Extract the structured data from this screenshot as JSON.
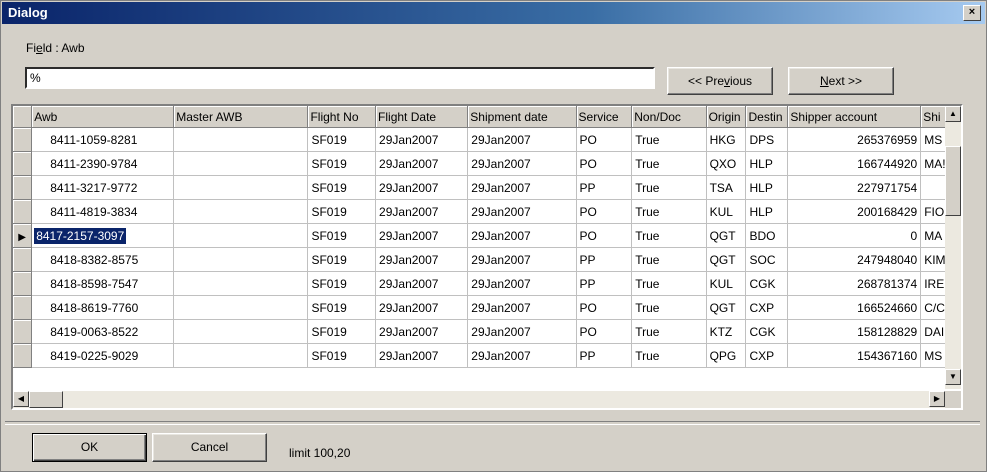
{
  "window": {
    "title": "Dialog",
    "close_glyph": "×"
  },
  "field": {
    "label_prefix": "Fi",
    "label_accel": "e",
    "label_suffix": "ld : Awb",
    "value": "%"
  },
  "nav": {
    "previous": "<< Pre",
    "previous_accel": "v",
    "previous_suffix": "ious",
    "next_accel": "N",
    "next": "ext >>"
  },
  "grid": {
    "columns": [
      "Awb",
      "Master AWB",
      "Flight No",
      "Flight Date",
      "Shipment date",
      "Service",
      "Non/Doc",
      "Origin",
      "Destin",
      "Shipper account",
      "Shi"
    ],
    "selected_row": 4,
    "rows": [
      [
        "8411-1059-8281",
        "",
        "SF019",
        "29Jan2007",
        "29Jan2007",
        "PO",
        "True",
        "HKG",
        "DPS",
        "265376959",
        "MS"
      ],
      [
        "8411-2390-9784",
        "",
        "SF019",
        "29Jan2007",
        "29Jan2007",
        "PO",
        "True",
        "QXO",
        "HLP",
        "166744920",
        "MA!"
      ],
      [
        "8411-3217-9772",
        "",
        "SF019",
        "29Jan2007",
        "29Jan2007",
        "PP",
        "True",
        "TSA",
        "HLP",
        "227971754",
        ""
      ],
      [
        "8411-4819-3834",
        "",
        "SF019",
        "29Jan2007",
        "29Jan2007",
        "PO",
        "True",
        "KUL",
        "HLP",
        "200168429",
        "FIO"
      ],
      [
        "8417-2157-3097",
        "",
        "SF019",
        "29Jan2007",
        "29Jan2007",
        "PO",
        "True",
        "QGT",
        "BDO",
        "0",
        "MA"
      ],
      [
        "8418-8382-8575",
        "",
        "SF019",
        "29Jan2007",
        "29Jan2007",
        "PP",
        "True",
        "QGT",
        "SOC",
        "247948040",
        "KIM"
      ],
      [
        "8418-8598-7547",
        "",
        "SF019",
        "29Jan2007",
        "29Jan2007",
        "PP",
        "True",
        "KUL",
        "CGK",
        "268781374",
        "IRE"
      ],
      [
        "8418-8619-7760",
        "",
        "SF019",
        "29Jan2007",
        "29Jan2007",
        "PO",
        "True",
        "QGT",
        "CXP",
        "166524660",
        "C/C"
      ],
      [
        "8419-0063-8522",
        "",
        "SF019",
        "29Jan2007",
        "29Jan2007",
        "PO",
        "True",
        "KTZ",
        "CGK",
        "158128829",
        "DAI"
      ],
      [
        "8419-0225-9029",
        "",
        "SF019",
        "29Jan2007",
        "29Jan2007",
        "PP",
        "True",
        "QPG",
        "CXP",
        "154367160",
        "MS"
      ]
    ]
  },
  "footer": {
    "ok": "OK",
    "cancel": "Cancel",
    "limit": "limit 100,20"
  },
  "icons": {
    "close": "close-icon",
    "row_pointer": "row-pointer-icon",
    "scroll_up": "arrow-up-icon",
    "scroll_down": "arrow-down-icon",
    "scroll_left": "arrow-left-icon",
    "scroll_right": "arrow-right-icon"
  },
  "colors": {
    "title_start": "#0a246a",
    "title_end": "#a6caf0",
    "face": "#d4d0c8",
    "selection": "#0a246a"
  }
}
